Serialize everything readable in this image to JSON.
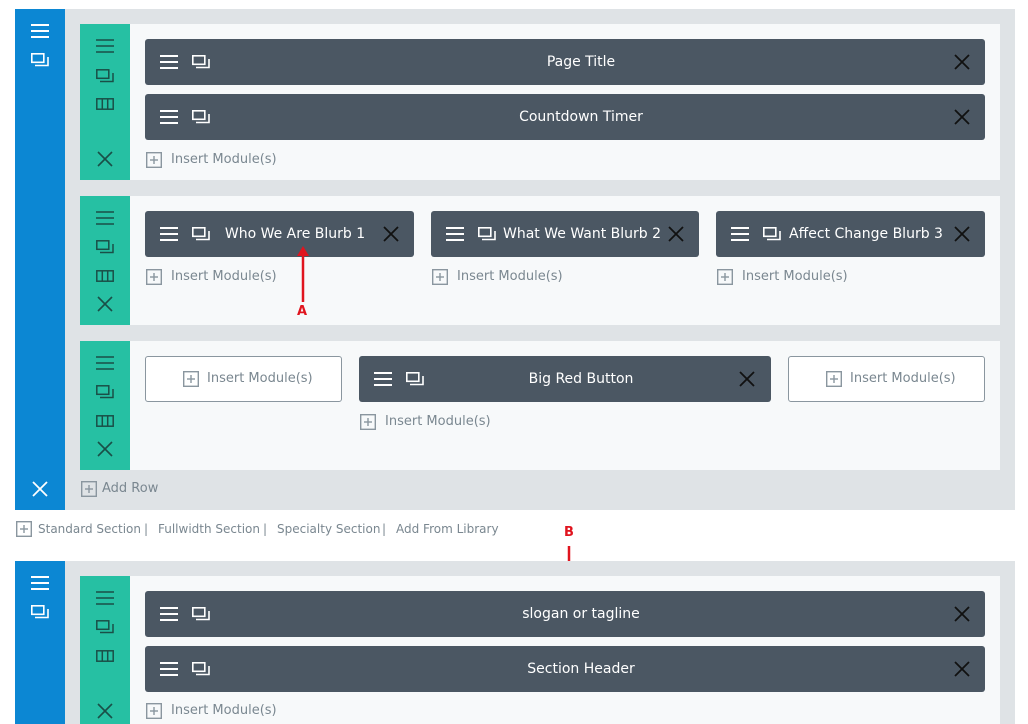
{
  "insert_label": "Insert Module(s)",
  "add_row_label": "Add Row",
  "section_links": [
    "Standard Section",
    "Fullwidth Section",
    "Specialty Section",
    "Add From Library"
  ],
  "separator": "|",
  "modules": {
    "page_title": "Page Title",
    "countdown": "Countdown Timer",
    "blurb1": "Who We Are Blurb 1",
    "blurb2": "What We Want Blurb 2",
    "blurb3": "Affect Change Blurb 3",
    "big_red_button": "Big Red Button",
    "slogan": "slogan or tagline",
    "section_header": "Section Header"
  },
  "annotations": {
    "a": "A",
    "b": "B"
  },
  "colors": {
    "section_handle": "#0c87d3",
    "row_handle": "#26c0a3",
    "module_bg": "#4b5763",
    "annotation": "#e0141e"
  },
  "icons": [
    "hamburger-icon",
    "duplicate-icon",
    "columns-icon",
    "close-icon",
    "plus-square-icon"
  ]
}
